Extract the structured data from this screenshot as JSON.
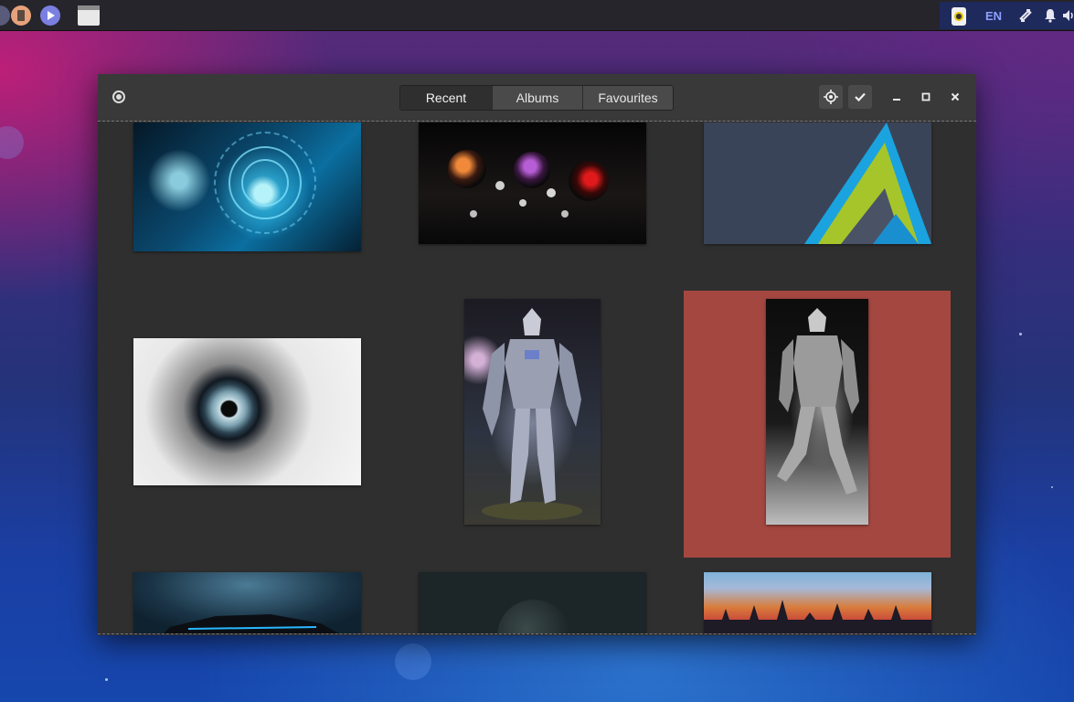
{
  "panel": {
    "tray": {
      "language": "EN"
    }
  },
  "window": {
    "tabs": [
      {
        "label": "Recent",
        "active": true
      },
      {
        "label": "Albums",
        "active": false
      },
      {
        "label": "Favourites",
        "active": false
      }
    ],
    "headerbar_buttons": [
      "location-target-icon",
      "checkmark-icon"
    ],
    "window_controls": [
      "minimize-icon",
      "maximize-icon",
      "close-icon"
    ]
  },
  "gallery": {
    "selected_index": 5,
    "selection_color": "#a44740",
    "thumbnails": [
      {
        "subject": "cyan tech circle wallpaper"
      },
      {
        "subject": "glossy spheres wallpaper"
      },
      {
        "subject": "green and blue mountain logo"
      },
      {
        "subject": "close-up eye wallpaper"
      },
      {
        "subject": "armored robot soldier"
      },
      {
        "subject": "grey armored robot"
      },
      {
        "subject": "dark sports car"
      },
      {
        "subject": "dark planet"
      },
      {
        "subject": "colorful city skyline"
      }
    ]
  }
}
